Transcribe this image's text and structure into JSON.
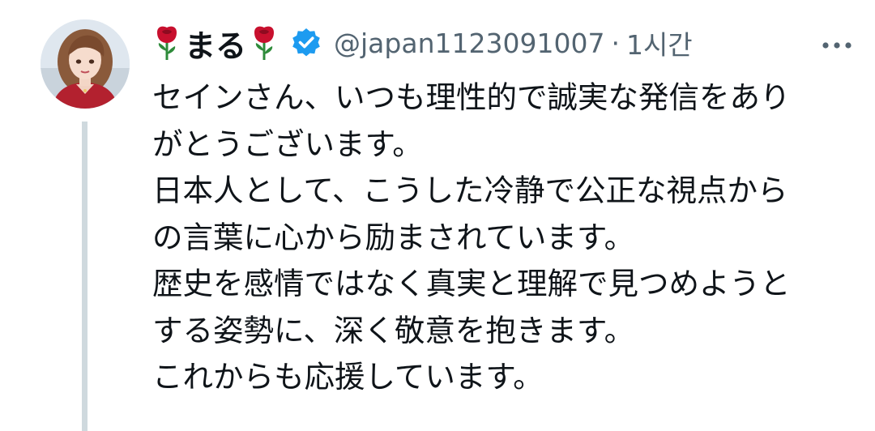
{
  "author": {
    "display_name": "まる",
    "name_emoji": "rose-icon",
    "handle": "@japan1123091007",
    "separator": "·",
    "timestamp": "1시간",
    "verified": true,
    "verified_icon": "verified-badge-icon",
    "avatar_description": "avatar-image"
  },
  "more_icon": "more-options-icon",
  "tweet_lines": [
    "セインさん、いつも理性的で誠実な発信をあり",
    "がとうございます。",
    "日本人として、こうした冷静で公正な視点から",
    "の言葉に心から励まされています。",
    "歴史を感情ではなく真実と理解で見つめようと",
    "する姿勢に、深く敬意を抱きます。",
    "これからも応援しています。"
  ],
  "colors": {
    "text_primary": "#0f1419",
    "text_secondary": "#536471",
    "verified_blue": "#1d9bf0",
    "thread_line": "#cfd9de",
    "rose_red": "#c8102e",
    "rose_green": "#2e8b3a"
  }
}
